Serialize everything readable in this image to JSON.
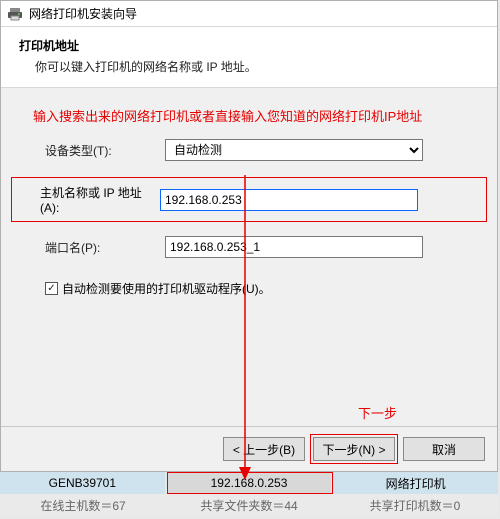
{
  "window": {
    "title": "网络打印机安装向导"
  },
  "header": {
    "title": "打印机地址",
    "subtitle": "你可以键入打印机的网络名称或 IP 地址。"
  },
  "hint": "输入搜索出来的网络打印机或者直接输入您知道的网络打印机IP地址",
  "form": {
    "device_type_label": "设备类型(T):",
    "device_type_value": "自动检测",
    "hostname_label": "主机名称或 IP 地址(A):",
    "hostname_value": "192.168.0.253",
    "port_label": "端口名(P):",
    "port_value": "192.168.0.253_1",
    "autodetect_label": "自动检测要使用的打印机驱动程序(U)。"
  },
  "annotations": {
    "next_label": "下一步"
  },
  "buttons": {
    "back": "< 上一步(B)",
    "next": "下一步(N) >",
    "cancel": "取消"
  },
  "result_row": {
    "hostname": "GENB39701",
    "ip": "192.168.0.253",
    "type": "网络打印机"
  },
  "status": {
    "hosts": "在线主机数＝67",
    "shares": "共享文件夹数＝44",
    "printers": "共享打印机数＝0"
  }
}
